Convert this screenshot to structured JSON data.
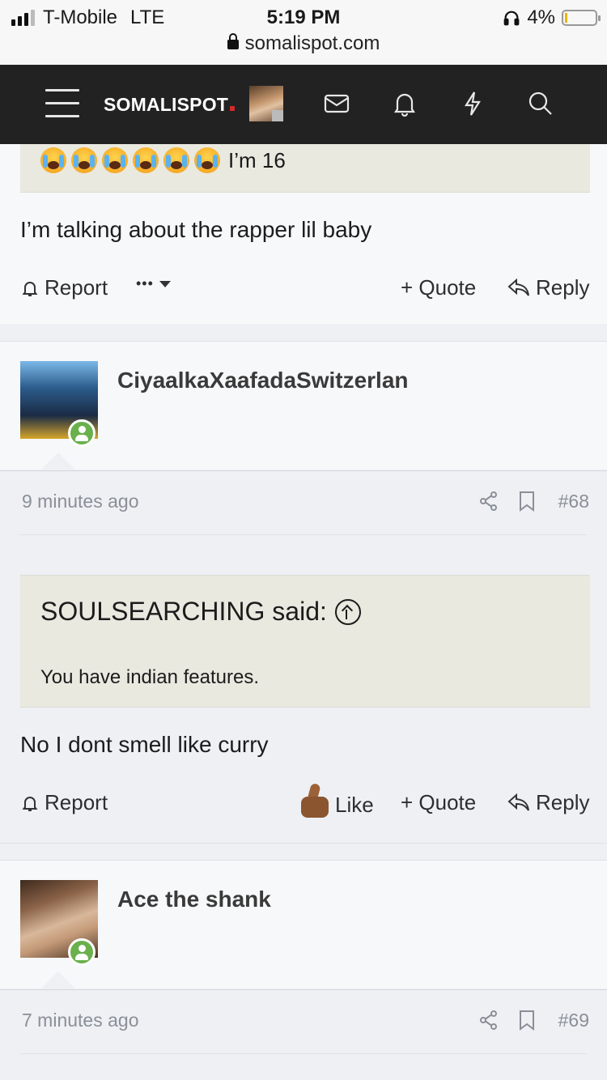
{
  "status_bar": {
    "carrier": "T-Mobile",
    "network": "LTE",
    "time": "5:19 PM",
    "battery": "4%",
    "url": "somalispot.com"
  },
  "navbar": {
    "brand": "SOMALISPOT"
  },
  "posts": [
    {
      "quote_tail": "I’m 16",
      "body": "I’m talking about the rapper lil baby",
      "actions": {
        "report": "Report",
        "more": "•••",
        "quote": "+ Quote",
        "reply": "Reply"
      }
    },
    {
      "username": "CiyaalkaXaafadaSwitzerlan",
      "time": "9 minutes ago",
      "number": "#68",
      "quote_author": "SOULSEARCHING said:",
      "quote_text": "You have indian features.",
      "body": "No I dont smell like curry",
      "actions": {
        "report": "Report",
        "like": "Like",
        "quote": "+ Quote",
        "reply": "Reply"
      }
    },
    {
      "username": "Ace the shank",
      "time": "7 minutes ago",
      "number": "#69"
    }
  ]
}
